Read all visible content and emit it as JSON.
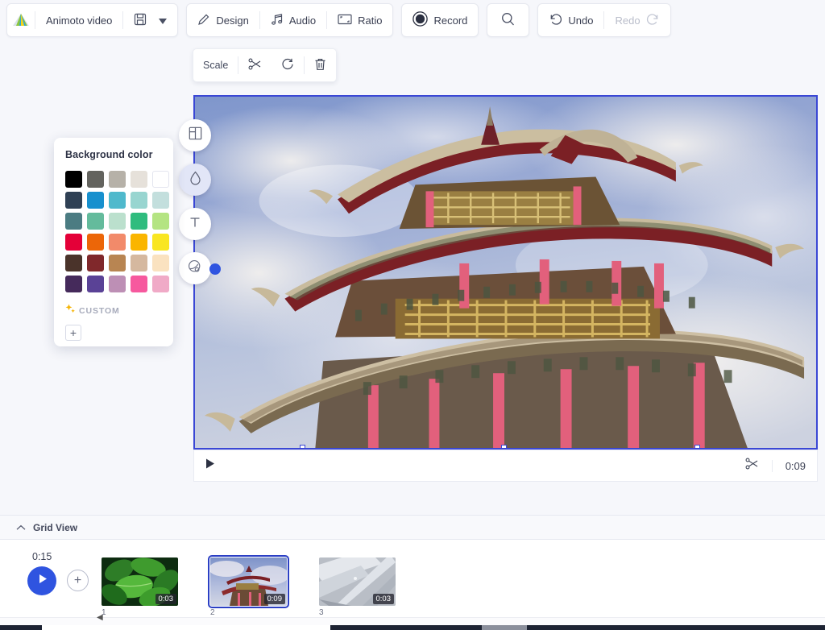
{
  "toolbar": {
    "logo_icon": "animoto-logo-icon",
    "project_name": "Animoto video",
    "save_icon": "floppy-disk-icon",
    "save_caret_icon": "caret-down-icon",
    "design_label": "Design",
    "design_icon": "pencil-icon",
    "audio_label": "Audio",
    "audio_icon": "music-note-icon",
    "ratio_label": "Ratio",
    "ratio_icon": "aspect-ratio-icon",
    "record_label": "Record",
    "record_icon": "record-circle-icon",
    "search_icon": "magnifier-icon",
    "undo_label": "Undo",
    "undo_icon": "undo-arrow-icon",
    "redo_label": "Redo",
    "redo_icon": "redo-arrow-icon"
  },
  "scalebar": {
    "scale_label": "Scale",
    "crop_icon": "scissors-icon",
    "rotate_icon": "rotate-cw-icon",
    "delete_icon": "trash-icon"
  },
  "rail": {
    "layout_icon": "layout-grid-icon",
    "color_icon": "droplet-icon",
    "text_icon": "text-t-icon",
    "filter_icon": "filter-lens-icon"
  },
  "bgpanel": {
    "title": "Background color",
    "custom_label": "CUSTOM",
    "custom_sparkle_icon": "sparkle-icon",
    "add_custom_icon": "plus-icon",
    "swatches": [
      "#000000",
      "#63635e",
      "#b6b1a8",
      "#e6e1da",
      "#ffffff",
      "#2f4054",
      "#1790ce",
      "#4fb9cc",
      "#98d5d0",
      "#c3dfdd",
      "#4b7c82",
      "#64bb9c",
      "#bbe0cd",
      "#2fbc7e",
      "#b4e482",
      "#e40038",
      "#ec6608",
      "#f28a6a",
      "#fab500",
      "#f9e622",
      "#4a332a",
      "#80282b",
      "#b88552",
      "#d5b89f",
      "#fae2c0",
      "#452a5b",
      "#5a4296",
      "#bd8fb5",
      "#f6599e",
      "#f0aac7"
    ]
  },
  "player": {
    "play_icon": "play-triangle-icon",
    "trim_icon": "scissors-icon",
    "duration": "0:09"
  },
  "gridview": {
    "chevron_icon": "chevron-up-icon",
    "label": "Grid View"
  },
  "timeline": {
    "total_duration": "0:15",
    "play_icon": "play-triangle-icon",
    "add_icon": "plus-icon",
    "scroll_left_icon": "caret-left-icon",
    "clips": [
      {
        "number": "1",
        "duration": "0:03",
        "thumb": "green-basil-leaves"
      },
      {
        "number": "2",
        "duration": "0:09",
        "thumb": "chinese-pagoda"
      },
      {
        "number": "3",
        "duration": "0:03",
        "thumb": "white-beams"
      }
    ]
  },
  "colors": {
    "accent": "#2f54e0",
    "selection_border": "#3a47d5",
    "panel_bg": "#ffffff",
    "app_bg": "#f6f7fb"
  }
}
